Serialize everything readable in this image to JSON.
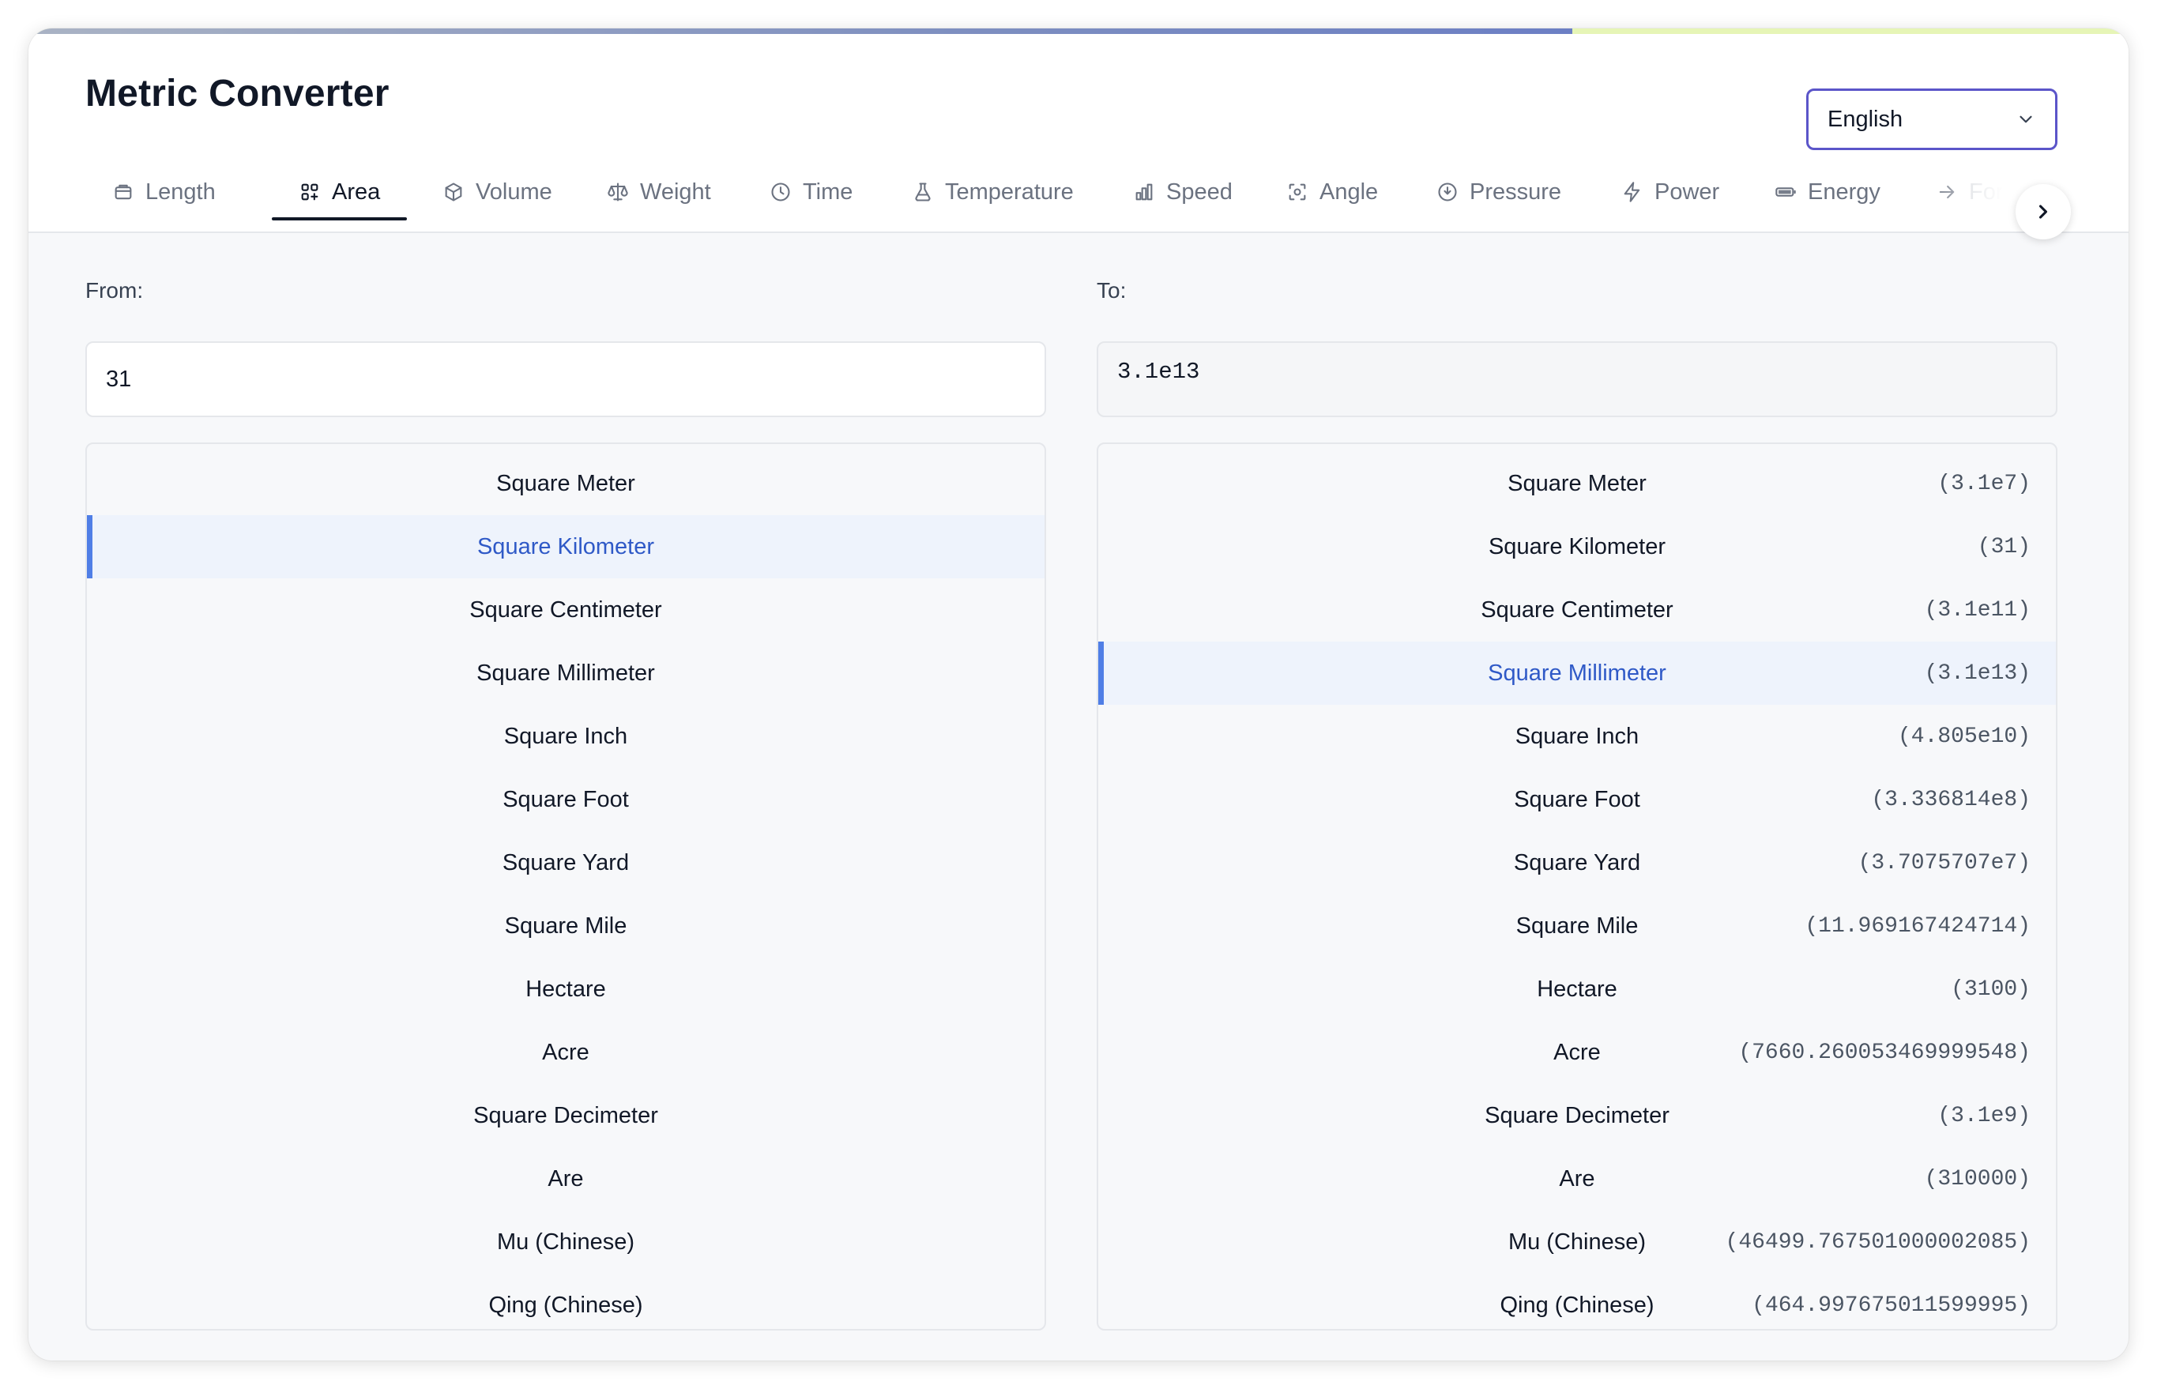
{
  "app": {
    "title": "Metric Converter",
    "progress_percent": 73.5
  },
  "language": {
    "selected": "English",
    "icon": "chevron-down-icon"
  },
  "tabs": [
    {
      "label": "Length",
      "icon": "ruler-icon",
      "active": false
    },
    {
      "label": "Area",
      "icon": "grid-icon",
      "active": true
    },
    {
      "label": "Volume",
      "icon": "cube-icon",
      "active": false
    },
    {
      "label": "Weight",
      "icon": "scale-icon",
      "active": false
    },
    {
      "label": "Time",
      "icon": "clock-icon",
      "active": false
    },
    {
      "label": "Temperature",
      "icon": "flask-icon",
      "active": false
    },
    {
      "label": "Speed",
      "icon": "bar-chart-icon",
      "active": false
    },
    {
      "label": "Angle",
      "icon": "focus-icon",
      "active": false
    },
    {
      "label": "Pressure",
      "icon": "gauge-icon",
      "active": false
    },
    {
      "label": "Power",
      "icon": "lightning-icon",
      "active": false
    },
    {
      "label": "Energy",
      "icon": "battery-icon",
      "active": false
    },
    {
      "label": "Force",
      "icon": "arrow-right-icon",
      "active": false
    }
  ],
  "tabs_next_icon": "chevron-right-icon",
  "from": {
    "label": "From:",
    "value": "31",
    "units": [
      {
        "label": "Square Meter",
        "selected": false
      },
      {
        "label": "Square Kilometer",
        "selected": true
      },
      {
        "label": "Square Centimeter",
        "selected": false
      },
      {
        "label": "Square Millimeter",
        "selected": false
      },
      {
        "label": "Square Inch",
        "selected": false
      },
      {
        "label": "Square Foot",
        "selected": false
      },
      {
        "label": "Square Yard",
        "selected": false
      },
      {
        "label": "Square Mile",
        "selected": false
      },
      {
        "label": "Hectare",
        "selected": false
      },
      {
        "label": "Acre",
        "selected": false
      },
      {
        "label": "Square Decimeter",
        "selected": false
      },
      {
        "label": "Are",
        "selected": false
      },
      {
        "label": "Mu (Chinese)",
        "selected": false
      },
      {
        "label": "Qing (Chinese)",
        "selected": false
      }
    ]
  },
  "to": {
    "label": "To:",
    "value": "3.1e13",
    "units": [
      {
        "label": "Square Meter",
        "value": "(3.1e7)",
        "selected": false
      },
      {
        "label": "Square Kilometer",
        "value": "(31)",
        "selected": false
      },
      {
        "label": "Square Centimeter",
        "value": "(3.1e11)",
        "selected": false
      },
      {
        "label": "Square Millimeter",
        "value": "(3.1e13)",
        "selected": true
      },
      {
        "label": "Square Inch",
        "value": "(4.805e10)",
        "selected": false
      },
      {
        "label": "Square Foot",
        "value": "(3.336814e8)",
        "selected": false
      },
      {
        "label": "Square Yard",
        "value": "(3.7075707e7)",
        "selected": false
      },
      {
        "label": "Square Mile",
        "value": "(11.969167424714)",
        "selected": false
      },
      {
        "label": "Hectare",
        "value": "(3100)",
        "selected": false
      },
      {
        "label": "Acre",
        "value": "(7660.260053469999548)",
        "selected": false
      },
      {
        "label": "Square Decimeter",
        "value": "(3.1e9)",
        "selected": false
      },
      {
        "label": "Are",
        "value": "(310000)",
        "selected": false
      },
      {
        "label": "Mu (Chinese)",
        "value": "(46499.767501000002085)",
        "selected": false
      },
      {
        "label": "Qing (Chinese)",
        "value": "(464.997675011599995)",
        "selected": false
      }
    ]
  }
}
